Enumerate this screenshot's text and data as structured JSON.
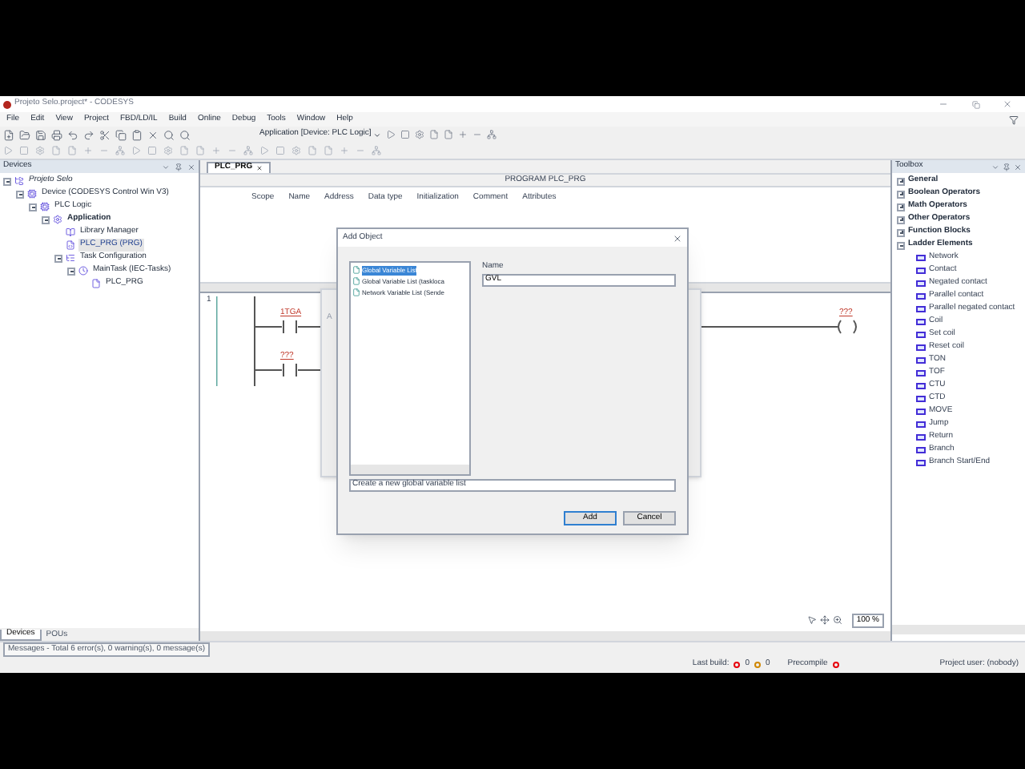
{
  "window": {
    "title": "Projeto Selo.project* - CODESYS"
  },
  "menu": [
    "File",
    "Edit",
    "View",
    "Project",
    "FBD/LD/IL",
    "Build",
    "Online",
    "Debug",
    "Tools",
    "Window",
    "Help"
  ],
  "toolbar": {
    "application": "Application [Device: PLC Logic]"
  },
  "devices_panel": {
    "title": "Devices",
    "tree": [
      {
        "label": "Projeto Selo",
        "kind": "project",
        "selected": false,
        "expanded": true,
        "children": [
          {
            "label": "Device (CODESYS Control Win V3)",
            "kind": "device",
            "selected": false,
            "expanded": true,
            "children": [
              {
                "label": "PLC Logic",
                "kind": "plc",
                "selected": false,
                "expanded": true,
                "children": [
                  {
                    "label": "Application",
                    "kind": "application",
                    "selected": false,
                    "expanded": true,
                    "children": [
                      {
                        "label": "Library Manager",
                        "kind": "library",
                        "selected": false
                      },
                      {
                        "label": "PLC_PRG (PRG)",
                        "kind": "pou",
                        "selected": true
                      },
                      {
                        "label": "Task Configuration",
                        "kind": "taskconfig",
                        "selected": false,
                        "expanded": true,
                        "children": [
                          {
                            "label": "MainTask (IEC-Tasks)",
                            "kind": "task",
                            "selected": false,
                            "expanded": true,
                            "children": [
                              {
                                "label": "PLC_PRG",
                                "kind": "call",
                                "selected": false
                              }
                            ]
                          }
                        ]
                      }
                    ]
                  }
                ]
              }
            ]
          }
        ]
      }
    ],
    "tabs": [
      {
        "label": "Devices",
        "selected": true
      },
      {
        "label": "POUs",
        "selected": false
      }
    ]
  },
  "editor": {
    "tab": "PLC_PRG",
    "header": "PROGRAM PLC_PRG",
    "columns": [
      "Scope",
      "Name",
      "Address",
      "Data type",
      "Initialization",
      "Comment",
      "Attributes"
    ],
    "network_number": "1",
    "contacts": [
      "1TGA",
      "???"
    ],
    "coil": "???",
    "zoom": "100 %"
  },
  "back_dialog": {
    "title": "A"
  },
  "dialog": {
    "title": "Add Object",
    "items": [
      {
        "label": "Global Variable List",
        "selected": true
      },
      {
        "label": "Global Variable List (taskloca",
        "selected": false
      },
      {
        "label": "Network Variable List (Sende",
        "selected": false
      }
    ],
    "name_label": "Name",
    "name_value": "GVL",
    "description": "Create a new global variable list",
    "buttons": [
      {
        "label": "Add",
        "default": true
      },
      {
        "label": "Cancel",
        "default": false
      }
    ]
  },
  "toolbox": {
    "title": "Toolbox",
    "groups": [
      {
        "label": "General",
        "expanded": false
      },
      {
        "label": "Boolean Operators",
        "expanded": false
      },
      {
        "label": "Math Operators",
        "expanded": false
      },
      {
        "label": "Other Operators",
        "expanded": false
      },
      {
        "label": "Function Blocks",
        "expanded": false
      },
      {
        "label": "Ladder Elements",
        "expanded": true,
        "items": [
          "Network",
          "Contact",
          "Negated contact",
          "Parallel contact",
          "Parallel negated contact",
          "Coil",
          "Set coil",
          "Reset coil",
          "TON",
          "TOF",
          "CTU",
          "CTD",
          "MOVE",
          "Jump",
          "Return",
          "Branch",
          "Branch Start/End"
        ]
      }
    ]
  },
  "messages": "Messages - Total 6 error(s), 0 warning(s), 0 message(s)",
  "status": {
    "last_build": "Last build:",
    "errors": "0",
    "warnings": "0",
    "precompile": "Precompile",
    "user": "Project user: (nobody)"
  }
}
